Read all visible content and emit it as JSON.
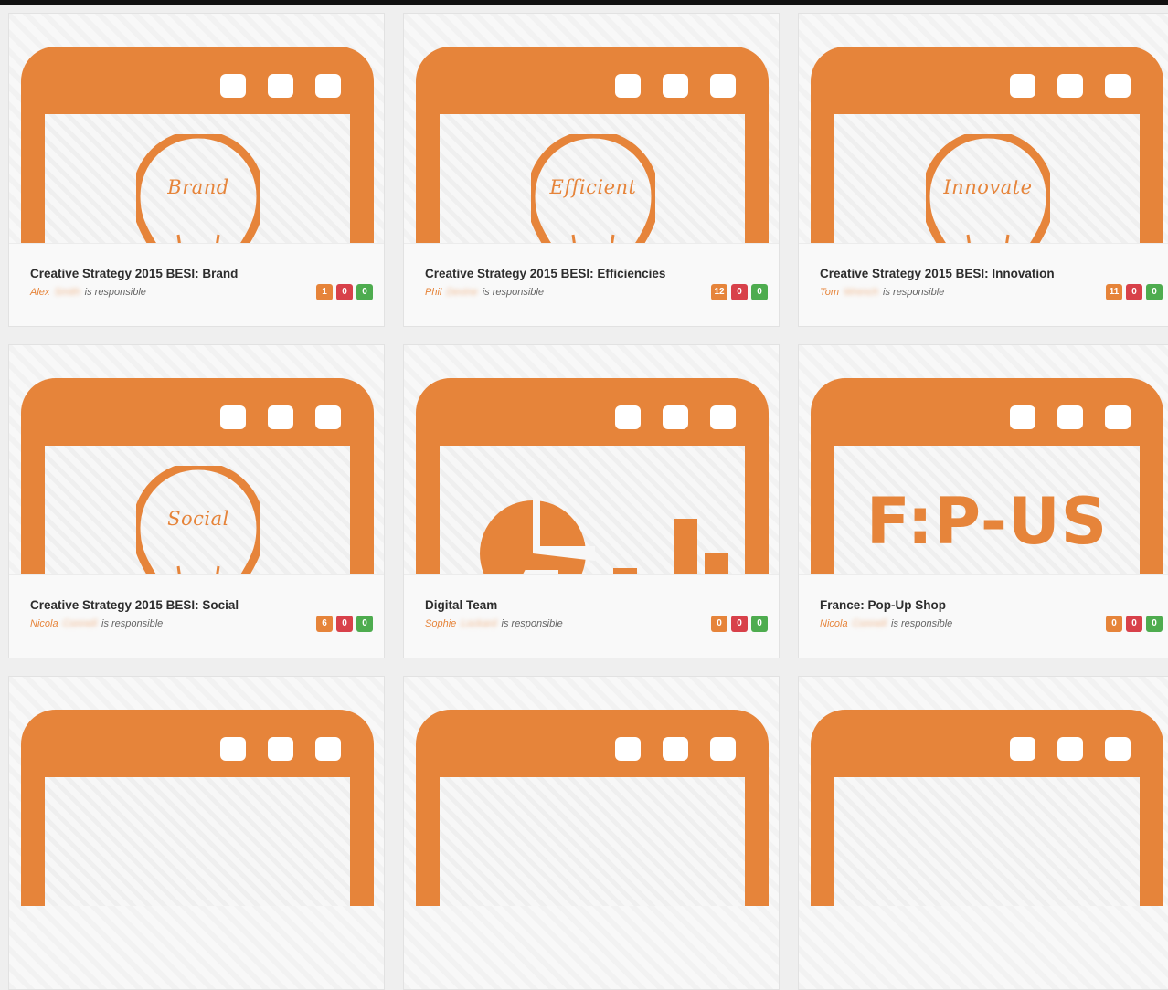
{
  "colors": {
    "accent": "#e6843a",
    "badge_red": "#d8414a",
    "badge_green": "#4eac4f"
  },
  "cards": [
    {
      "art": "bulb",
      "art_word": "Brand",
      "title": "Creative Strategy 2015 BESI: Brand",
      "first_name": "Alex",
      "last_name": "Smith",
      "suffix": "is responsible",
      "badges": [
        "1",
        "0",
        "0"
      ]
    },
    {
      "art": "bulb",
      "art_word": "Efficient",
      "title": "Creative Strategy 2015 BESI: Efficiencies",
      "first_name": "Phil",
      "last_name": "Devine",
      "suffix": "is responsible",
      "badges": [
        "12",
        "0",
        "0"
      ]
    },
    {
      "art": "bulb",
      "art_word": "Innovate",
      "title": "Creative Strategy 2015 BESI: Innovation",
      "first_name": "Tom",
      "last_name": "Wrench",
      "suffix": "is responsible",
      "badges": [
        "11",
        "0",
        "0"
      ]
    },
    {
      "art": "bulb",
      "art_word": "Social",
      "title": "Creative Strategy 2015 BESI: Social",
      "first_name": "Nicola",
      "last_name": "Connell",
      "suffix": "is responsible",
      "badges": [
        "6",
        "0",
        "0"
      ]
    },
    {
      "art": "stats",
      "art_word": "",
      "title": "Digital Team",
      "first_name": "Sophie",
      "last_name": "Lockard",
      "suffix": "is responsible",
      "badges": [
        "0",
        "0",
        "0"
      ]
    },
    {
      "art": "text",
      "art_word": "F:P-US",
      "title": "France: Pop-Up Shop",
      "first_name": "Nicola",
      "last_name": "Connell",
      "suffix": "is responsible",
      "badges": [
        "0",
        "0",
        "0"
      ]
    },
    {
      "art": "browser",
      "art_word": "",
      "title": "",
      "first_name": "",
      "last_name": "",
      "suffix": "",
      "badges": []
    },
    {
      "art": "browser",
      "art_word": "",
      "title": "",
      "first_name": "",
      "last_name": "",
      "suffix": "",
      "badges": []
    },
    {
      "art": "browser",
      "art_word": "",
      "title": "",
      "first_name": "",
      "last_name": "",
      "suffix": "",
      "badges": []
    }
  ]
}
